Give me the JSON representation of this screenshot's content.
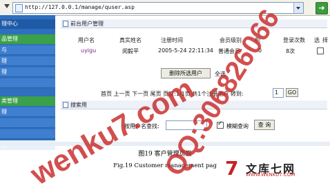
{
  "address_bar": {
    "url": "http://127.0.0.1/manage/quser.asp"
  },
  "sidebar": {
    "items": [
      "理中心",
      "品管理",
      "与",
      "理",
      "理",
      "",
      "类管理",
      "理",
      "",
      "",
      "理"
    ]
  },
  "user_panel": {
    "title": "前台用户管理",
    "columns": [
      "用户名",
      "真实姓名",
      "注册时间",
      "会员级别",
      "积",
      "登录次数",
      "选",
      "择"
    ],
    "rows": [
      {
        "username": "uyigu",
        "realname": "闵毅平",
        "reg_time": "2005-5-24 22:11:34",
        "level": "普通会员",
        "points": "0",
        "logins": "8次"
      }
    ],
    "delete_button": "删除所选用户",
    "select_all": "全选",
    "pagination": "首页 上一页 下一页 尾页 页次:1/1页 共1个注册用户 转到:",
    "page_input": "1",
    "go_button": "GO"
  },
  "search_panel": {
    "title": "搜索用",
    "label": "按用户名查找:",
    "input_value": "",
    "fuzzy_label": "模糊查询",
    "fuzzy_checked": true,
    "search_button": "查 询"
  },
  "captions": {
    "cn": "图19  客户管理页面",
    "en": "Fig.19  Customer management pag"
  },
  "watermarks": {
    "site": "wenku7.com",
    "qq": "QQ:306826066",
    "brand": "文库七网",
    "brand_url": "WWW.WENKU7.COM"
  },
  "colors": {
    "sidebar": "#2f6fbf",
    "watermark": "#c82828",
    "link": "#7a1a7a"
  }
}
